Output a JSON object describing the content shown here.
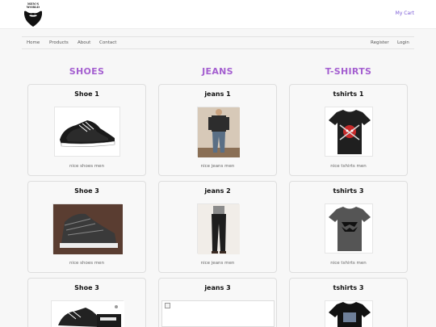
{
  "brand": {
    "logo_text": "MEN'S WORLD",
    "logo_icon": "beard-icon"
  },
  "header": {
    "cart_label": "My Cart"
  },
  "nav": {
    "left": [
      "Home",
      "Products",
      "About",
      "Contact"
    ],
    "right": [
      "Register",
      "Login"
    ]
  },
  "categories": [
    {
      "title": "SHOES",
      "products": [
        {
          "name": "Shoe 1",
          "desc": "nice shoes men"
        },
        {
          "name": "Shoe 3",
          "desc": "nice shoes men"
        },
        {
          "name": "Shoe 3",
          "desc": ""
        }
      ]
    },
    {
      "title": "JEANS",
      "products": [
        {
          "name": "jeans 1",
          "desc": "nice jeans men"
        },
        {
          "name": "jeans 2",
          "desc": "nice jeans men"
        },
        {
          "name": "jeans 3",
          "desc": ""
        }
      ]
    },
    {
      "title": "T-SHIRTS",
      "products": [
        {
          "name": "tshirts 1",
          "desc": "nice tshirts men"
        },
        {
          "name": "tshirts 3",
          "desc": "nice tshirts men"
        },
        {
          "name": "tshirts 3",
          "desc": ""
        }
      ]
    }
  ],
  "colors": {
    "accent": "#a45fd0",
    "link": "#7b5bd6"
  }
}
